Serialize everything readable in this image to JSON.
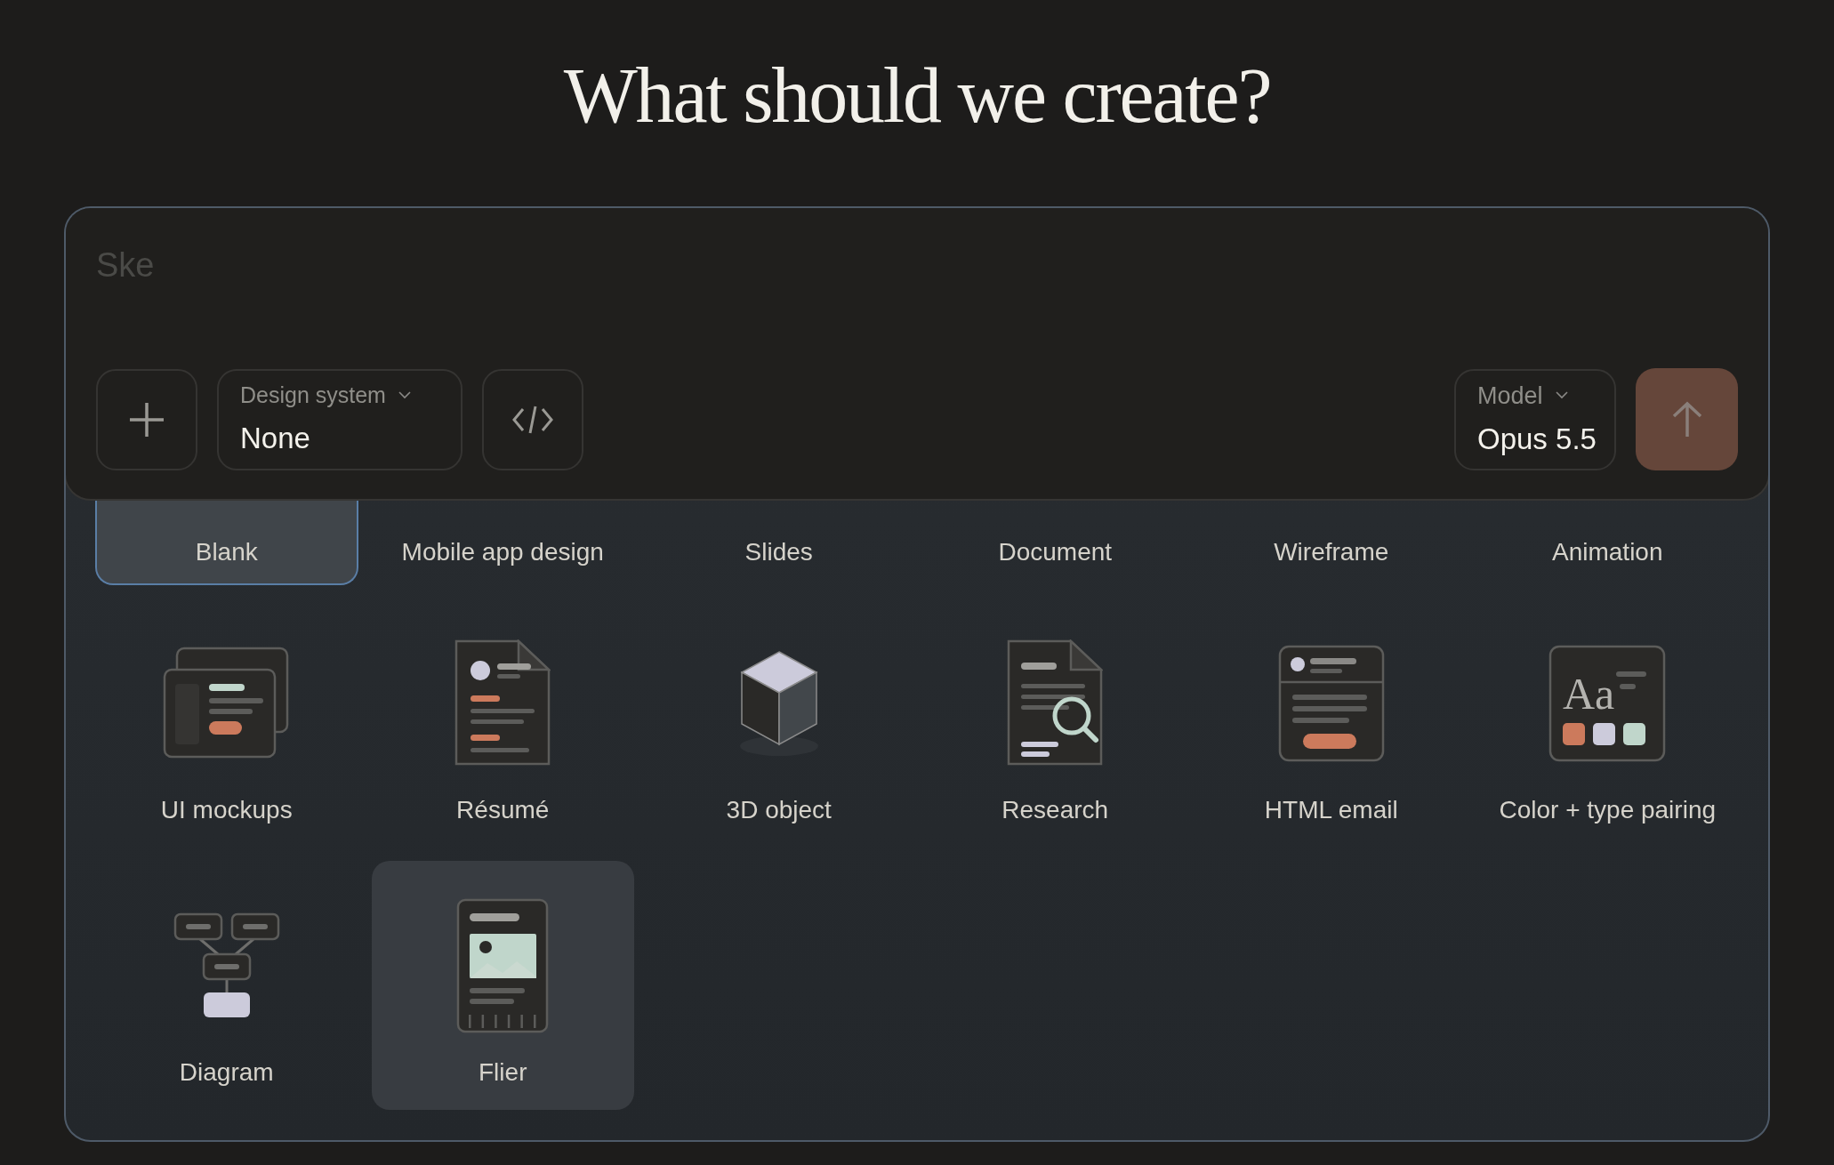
{
  "title": "What should we create?",
  "prompt": {
    "placeholder": "Ske"
  },
  "design_system": {
    "label": "Design system",
    "value": "None"
  },
  "model": {
    "label": "Model",
    "value": "Opus 5.5"
  },
  "send_button": {
    "disabled": true
  },
  "templates": [
    {
      "label": "Blank",
      "selected": true,
      "hovered": false
    },
    {
      "label": "Mobile app design",
      "selected": false,
      "hovered": false
    },
    {
      "label": "Slides",
      "selected": false,
      "hovered": false
    },
    {
      "label": "Document",
      "selected": false,
      "hovered": false
    },
    {
      "label": "Wireframe",
      "selected": false,
      "hovered": false
    },
    {
      "label": "Animation",
      "selected": false,
      "hovered": false
    },
    {
      "label": "UI mockups",
      "selected": false,
      "hovered": false
    },
    {
      "label": "Résumé",
      "selected": false,
      "hovered": false
    },
    {
      "label": "3D object",
      "selected": false,
      "hovered": false
    },
    {
      "label": "Research",
      "selected": false,
      "hovered": false
    },
    {
      "label": "HTML email",
      "selected": false,
      "hovered": false
    },
    {
      "label": "Color + type pairing",
      "selected": false,
      "hovered": false,
      "icon_text": "Aa"
    },
    {
      "label": "Diagram",
      "selected": false,
      "hovered": false
    },
    {
      "label": "Flier",
      "selected": false,
      "hovered": true
    }
  ]
}
